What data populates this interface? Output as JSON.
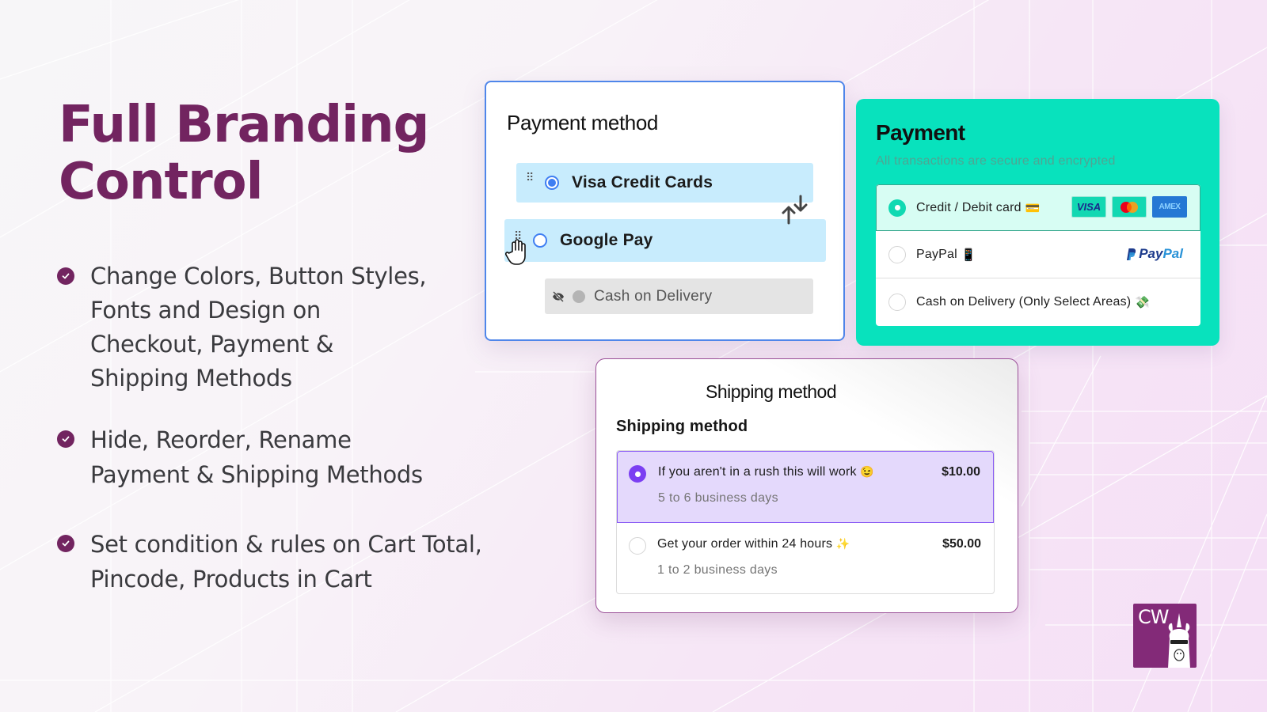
{
  "hero": {
    "title_line1": "Full Branding",
    "title_line2": "Control",
    "title_color": "#722460"
  },
  "features": [
    {
      "lines": [
        "Change Colors, Button Styles,",
        "Fonts and Design on",
        "Checkout, Payment &",
        "Shipping Methods"
      ],
      "icon": "check-circle-icon"
    },
    {
      "lines": [
        "Hide, Reorder, Rename",
        "Payment & Shipping Methods"
      ],
      "icon": "check-circle-icon"
    },
    {
      "lines": [
        "Set condition & rules on Cart Total,",
        "Pincode, Products in Cart"
      ],
      "icon": "check-circle-icon"
    }
  ],
  "payment_editor": {
    "title": "Payment method",
    "accent": "#4f86ea",
    "items": [
      {
        "label": "Visa Credit Cards",
        "selected": true,
        "hidden": false
      },
      {
        "label": "Google Pay",
        "selected": false,
        "hidden": false,
        "dragging": true
      },
      {
        "label": "Cash on Delivery",
        "selected": false,
        "hidden": true
      }
    ]
  },
  "payment_branded": {
    "title": "Payment",
    "subtitle": "All transactions are secure and encrypted",
    "accent": "#08e2bd",
    "options": [
      {
        "label": "Credit / Debit card",
        "emoji": "💳",
        "selected": true,
        "badges": [
          "VISA",
          "Mastercard",
          "AMEX"
        ]
      },
      {
        "label": "PayPal",
        "emoji": "📱",
        "selected": false,
        "logo_pay": "Pay",
        "logo_pal": "Pal"
      },
      {
        "label": "Cash on Delivery (Only Select Areas)",
        "emoji": "💸",
        "selected": false
      }
    ]
  },
  "shipping": {
    "title": "Shipping method",
    "subtitle": "Shipping method",
    "accent": "#7b3ff2",
    "options": [
      {
        "name": "If you aren't in a rush this will work",
        "emoji": "😉",
        "days": "5 to 6 business days",
        "price": "$10.00",
        "selected": true
      },
      {
        "name": "Get your order within 24 hours",
        "emoji": "✨",
        "days": "1 to 2 business days",
        "price": "$50.00",
        "selected": false
      }
    ]
  },
  "brand_logo": {
    "text": "CW",
    "color": "#832a78"
  }
}
